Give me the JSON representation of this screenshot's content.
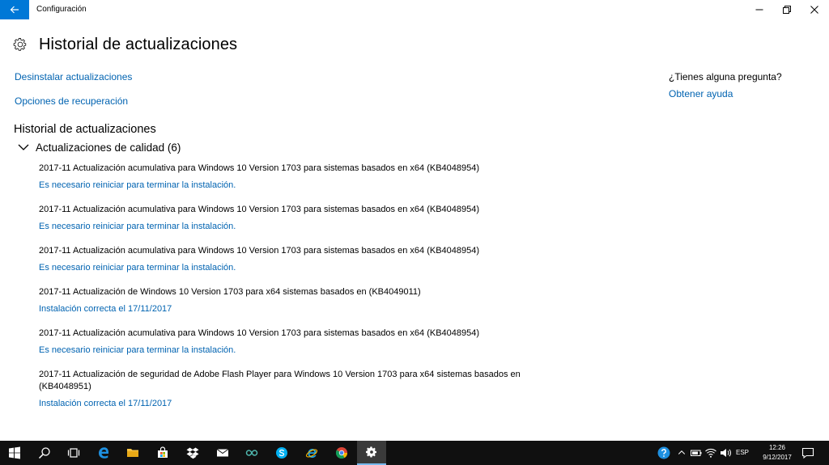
{
  "window": {
    "title": "Configuración"
  },
  "header": {
    "title": "Historial de actualizaciones"
  },
  "links": {
    "uninstall": "Desinstalar actualizaciones",
    "recovery": "Opciones de recuperación"
  },
  "section": {
    "title": "Historial de actualizaciones"
  },
  "group": {
    "label": "Actualizaciones de calidad (6)",
    "expanded": true
  },
  "updates": [
    {
      "title": "2017-11 Actualización acumulativa para Windows 10 Version 1703 para sistemas basados en x64 (KB4048954)",
      "status": "Es necesario reiniciar para terminar la instalación."
    },
    {
      "title": "2017-11 Actualización acumulativa para Windows 10 Version 1703 para sistemas basados en x64 (KB4048954)",
      "status": "Es necesario reiniciar para terminar la instalación."
    },
    {
      "title": "2017-11 Actualización acumulativa para Windows 10 Version 1703 para sistemas basados en x64 (KB4048954)",
      "status": "Es necesario reiniciar para terminar la instalación."
    },
    {
      "title": "2017-11 Actualización de Windows 10 Version 1703 para x64 sistemas basados en (KB4049011)",
      "status": "Instalación correcta el 17/11/2017"
    },
    {
      "title": "2017-11 Actualización acumulativa para Windows 10 Version 1703 para sistemas basados en x64 (KB4048954)",
      "status": "Es necesario reiniciar para terminar la instalación."
    },
    {
      "title": "2017-11 Actualización de seguridad de Adobe Flash Player para Windows 10 Version 1703 para x64 sistemas basados en (KB4048951)",
      "status": "Instalación correcta el 17/11/2017"
    }
  ],
  "help": {
    "question": "¿Tienes alguna pregunta?",
    "link": "Obtener ayuda"
  },
  "taskbar": {
    "items": [
      "windows-start-icon",
      "search-icon",
      "task-view-icon",
      "edge-icon",
      "file-explorer-icon",
      "store-icon",
      "dropbox-icon",
      "mail-icon",
      "arduino-icon",
      "skype-icon",
      "internet-explorer-icon",
      "chrome-icon",
      "settings-icon"
    ],
    "active_item": "settings-icon",
    "tray": {
      "language": "ESP",
      "time": "12:26",
      "date": "9/12/2017"
    }
  },
  "colors": {
    "accent": "#0078d7",
    "link": "#0063b1",
    "taskbar": "#101010"
  }
}
